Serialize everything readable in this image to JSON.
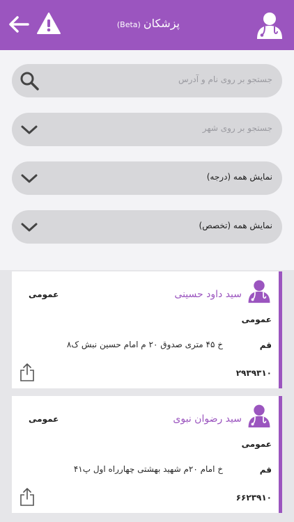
{
  "header": {
    "title": "پزشکان",
    "beta": "(Beta)",
    "back_icon": "arrow-left-icon",
    "warning_icon": "warning-icon",
    "logo_icon": "doctor-icon"
  },
  "colors": {
    "primary": "#9b55bf",
    "field_bg": "#d7d7da",
    "panel_bg": "#f3f3f6",
    "page_bg": "#e6e6e9"
  },
  "filters": {
    "search": {
      "placeholder": "جستجو بر روی نام و آدرس",
      "icon": "search-icon"
    },
    "city": {
      "placeholder": "جستجو بر روی شهر",
      "icon": "chevron-down-icon"
    },
    "degree": {
      "value": "نمایش همه (درجه)",
      "icon": "chevron-down-icon"
    },
    "specialty": {
      "value": "نمایش همه (تخصص)",
      "icon": "chevron-down-icon"
    }
  },
  "doctors": [
    {
      "name": "سید داود حسینی",
      "tag": "عمومی",
      "specialty": "عمومی",
      "city": "قم",
      "address": "خ ۴۵ متری صدوق ۲۰ م امام حسین نبش ک۸",
      "phone": "۲۹۳۹۳۱۰"
    },
    {
      "name": "سید رضوان نبوی",
      "tag": "عمومی",
      "specialty": "عمومی",
      "city": "قم",
      "address": "خ امام ۲۰م شهید بهشتی چهارراه اول پ۴۱",
      "phone": "۶۶۲۳۹۱۰"
    }
  ]
}
